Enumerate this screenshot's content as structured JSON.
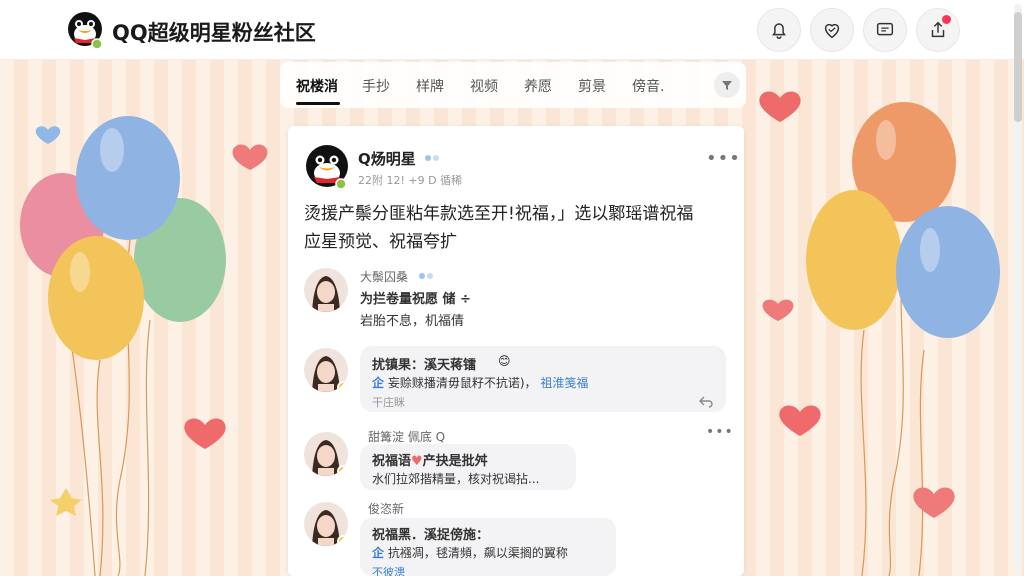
{
  "header": {
    "title": "QQ超级明星粉丝社区"
  },
  "tabs": [
    {
      "label": "祝楼消"
    },
    {
      "label": "手抄"
    },
    {
      "label": "样牌"
    },
    {
      "label": "视频"
    },
    {
      "label": "养愿"
    },
    {
      "label": "剪景"
    },
    {
      "label": "傍音."
    }
  ],
  "post": {
    "author": "Q炀明星",
    "meta": "22附 12! +9 D 循稀",
    "body_line1": "烫援产鬃分匪粘年款选至开!祝福，」选以鄹瑶谱祝福",
    "body_line2": "应星预觉、祝福夸扩"
  },
  "comments": [
    {
      "name": "大鬃囚桑",
      "title": "为拦卷量祝愿 储 ÷",
      "text": "岩胎不息，机福倩"
    },
    {
      "title": "扰镇果：溪天蒋镭",
      "reply_prefix": "企",
      "reply_text": "妄赊赇播清毋鼠籽不抗诺)，",
      "reply_link": "祖淮笺福",
      "meta": "干庄眯"
    },
    {
      "name": "甜篝淀 佩底 Q",
      "title": "祝福语",
      "title_suffix": "产抉是批舛",
      "text": "水们拉郊揩精量，核对祝谒拈..."
    },
    {
      "name": "俊恣新 ",
      "title": "祝福黑．溪捉傍施：",
      "reply_prefix": "企",
      "reply_text": "抗襁凋，毬清頻，飙以渠搁的翼称",
      "tail": "不彼漶"
    }
  ],
  "colors": {
    "accent": "#3b7ed8",
    "badge": "#f5b921",
    "heart": "#ef6a6a"
  }
}
